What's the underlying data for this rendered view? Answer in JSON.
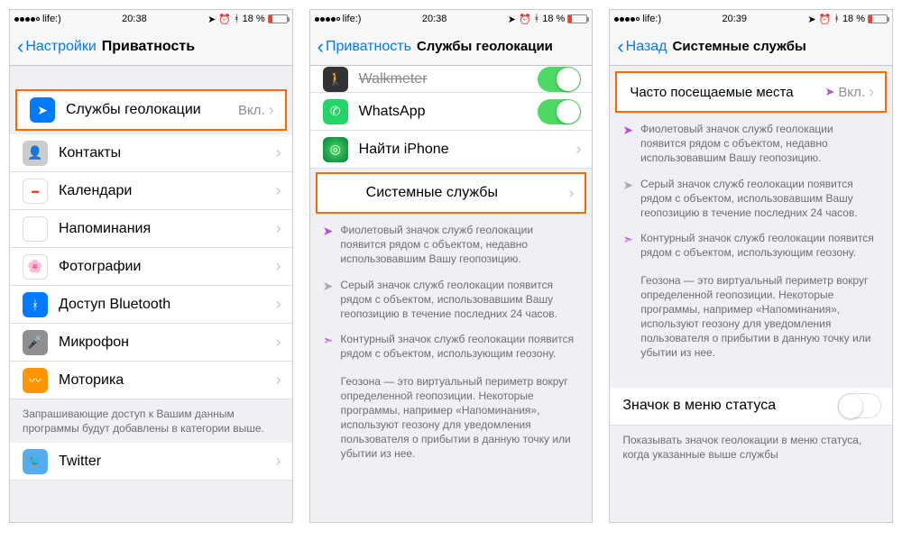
{
  "status": {
    "carrier": "life:)",
    "time1": "20:38",
    "time3": "20:39",
    "battery": "18 %"
  },
  "screen1": {
    "back": "Настройки",
    "title": "Приватность",
    "rows": {
      "location": "Службы геолокации",
      "location_value": "Вкл.",
      "contacts": "Контакты",
      "calendars": "Календари",
      "reminders": "Напоминания",
      "photos": "Фотографии",
      "bluetooth": "Доступ Bluetooth",
      "microphone": "Микрофон",
      "motion": "Моторика"
    },
    "footer": "Запрашивающие доступ к Вашим данным программы будут добавлены в категории выше.",
    "twitter": "Twitter"
  },
  "screen2": {
    "back": "Приватность",
    "title": "Службы геолокации",
    "walkmeter": "Walkmeter",
    "whatsapp": "WhatsApp",
    "findiphone": "Найти iPhone",
    "system": "Системные службы",
    "legend1": "Фиолетовый значок служб геолокации появится рядом с объектом, недавно использовавшим Вашу геопозицию.",
    "legend2": "Серый значок служб геолокации появится рядом с объектом, использовавшим Вашу геопозицию в течение последних 24 часов.",
    "legend3": "Контурный значок служб геолокации появится рядом с объектом, использующим геозону.",
    "geofence": "Геозона — это виртуальный периметр вокруг определенной геопозиции. Некоторые программы, например «Напоминания», используют геозону для уведомления пользователя о прибытии в данную точку или убытии из нее."
  },
  "screen3": {
    "back": "Назад",
    "title": "Системные службы",
    "frequent": "Часто посещаемые места",
    "frequent_value": "Вкл.",
    "legend1": "Фиолетовый значок служб геолокации появится рядом с объектом, недавно использовавшим Вашу геопозицию.",
    "legend2": "Серый значок служб геолокации появится рядом с объектом, использовавшим Вашу геопозицию в течение последних 24 часов.",
    "legend3": "Контурный значок служб геолокации появится рядом с объектом, использующим геозону.",
    "geofence": "Геозона — это виртуальный периметр вокруг определенной геопозиции. Некоторые программы, например «Напоминания», используют геозону для уведомления пользователя о прибытии в данную точку или убытии из нее.",
    "status_icon": "Значок в меню статуса",
    "status_footer": "Показывать значок геолокации в меню статуса, когда указанные выше службы"
  }
}
